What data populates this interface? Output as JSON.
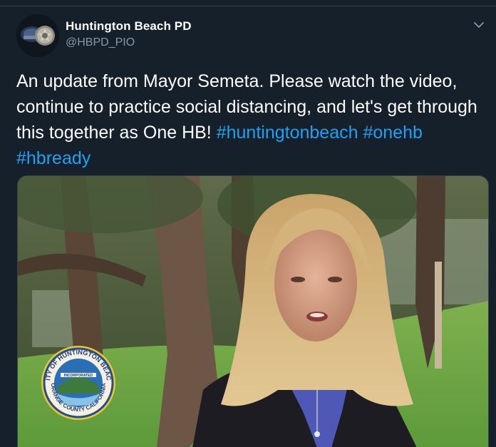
{
  "tweet": {
    "display_name": "Huntington Beach PD",
    "handle": "@HBPD_PIO",
    "text_plain": "An update from Mayor Semeta. Please watch the video, continue to practice social distancing, and let's get through this together as One HB!",
    "hashtags": [
      "#huntingtonbeach",
      "#onehb",
      "#hbready"
    ]
  },
  "media": {
    "seal_top_text": "CITY OF HUNTINGTON BEACH",
    "seal_bottom_text": "ORANGE COUNTY CALIFORNIA",
    "seal_inner_text": "INCORPORATED"
  },
  "icons": {
    "menu": "chevron-down-icon"
  },
  "colors": {
    "background": "#15202b",
    "link": "#1da1f2",
    "secondary_text": "#8899a6",
    "border": "#38444d"
  }
}
